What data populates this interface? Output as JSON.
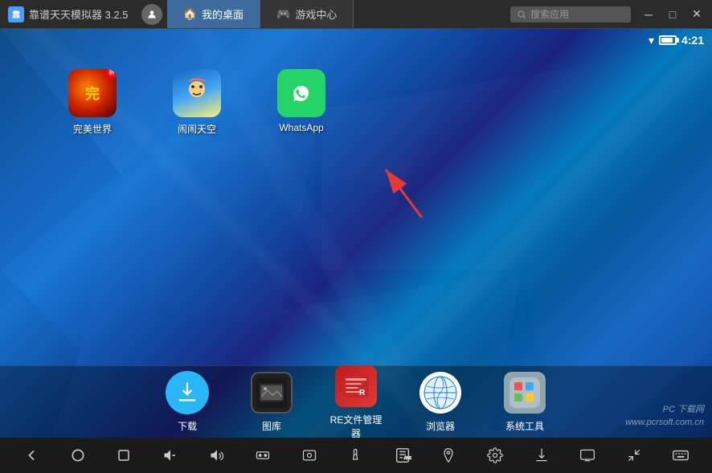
{
  "titlebar": {
    "app_name": "靠谱天天模拟器 3.2.5",
    "tab_desktop": "我的桌面",
    "tab_games": "游戏中心",
    "search_placeholder": "搜索应用",
    "win_min": "─",
    "win_max": "□",
    "win_close": "✕"
  },
  "statusbar": {
    "time": "4:21"
  },
  "desktop": {
    "apps": [
      {
        "id": "perfect-world",
        "label": "完美世界",
        "badge": "新"
      },
      {
        "id": "naonao-sky",
        "label": "闹闹天空"
      },
      {
        "id": "whatsapp",
        "label": "WhatsApp"
      }
    ]
  },
  "dock": {
    "items": [
      {
        "id": "download",
        "label": "下载"
      },
      {
        "id": "gallery",
        "label": "图库"
      },
      {
        "id": "re-manager",
        "label": "RE文件管理器"
      },
      {
        "id": "browser",
        "label": "浏览器"
      },
      {
        "id": "system-tools",
        "label": "系统工具"
      }
    ]
  },
  "watermark": {
    "line1": "PC 下载网",
    "line2": "www.pcrsoft.com.cn"
  }
}
